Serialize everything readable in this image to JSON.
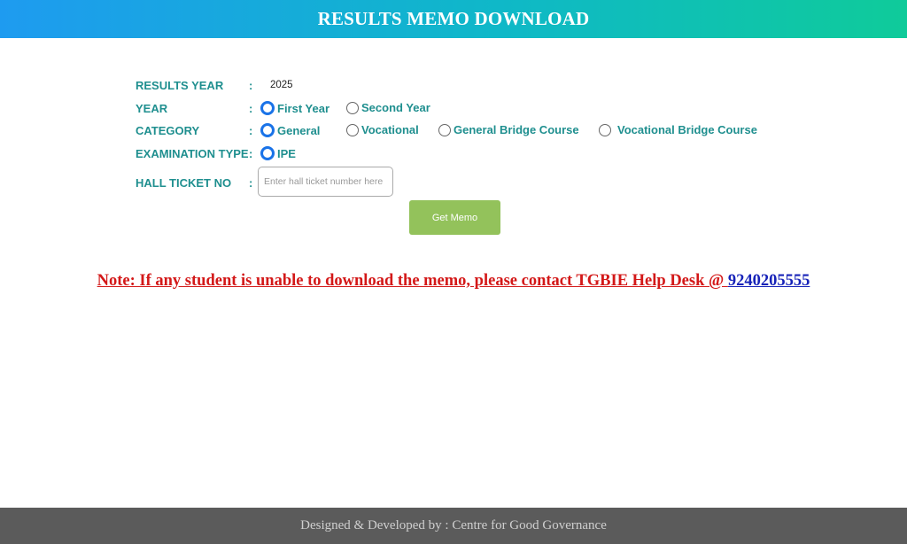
{
  "header": {
    "title": "RESULTS MEMO DOWNLOAD"
  },
  "form": {
    "results_year": {
      "label": "RESULTS YEAR",
      "colon": ":",
      "value": "2025"
    },
    "year": {
      "label": "YEAR",
      "colon": ":",
      "options": [
        {
          "label": "First Year",
          "selected": true
        },
        {
          "label": "Second Year",
          "selected": false
        }
      ]
    },
    "category": {
      "label": "CATEGORY",
      "colon": ":",
      "options": [
        {
          "label": "General",
          "selected": true
        },
        {
          "label": "Vocational",
          "selected": false
        },
        {
          "label": "General Bridge Course",
          "selected": false
        },
        {
          "label": "Vocational Bridge Course",
          "selected": false
        }
      ]
    },
    "exam_type": {
      "label": "EXAMINATION TYPE",
      "colon": ":",
      "options": [
        {
          "label": "IPE",
          "selected": true
        }
      ]
    },
    "hall_ticket": {
      "label": "HALL TICKET NO",
      "colon": ":",
      "placeholder": "Enter hall ticket number here",
      "value": ""
    },
    "submit_label": "Get Memo"
  },
  "note": {
    "text": "Note: If any student is unable to download the memo, please contact TGBIE Help Desk @ ",
    "phone": "9240205555"
  },
  "footer": {
    "text": "Designed & Developed by : Centre for Good Governance"
  },
  "colors": {
    "accent": "#1a73e8",
    "label": "#1f8f8f",
    "button": "#93c25b",
    "note": "#d31818",
    "link": "#1622b8",
    "footer_bg": "#5b5b5b"
  }
}
